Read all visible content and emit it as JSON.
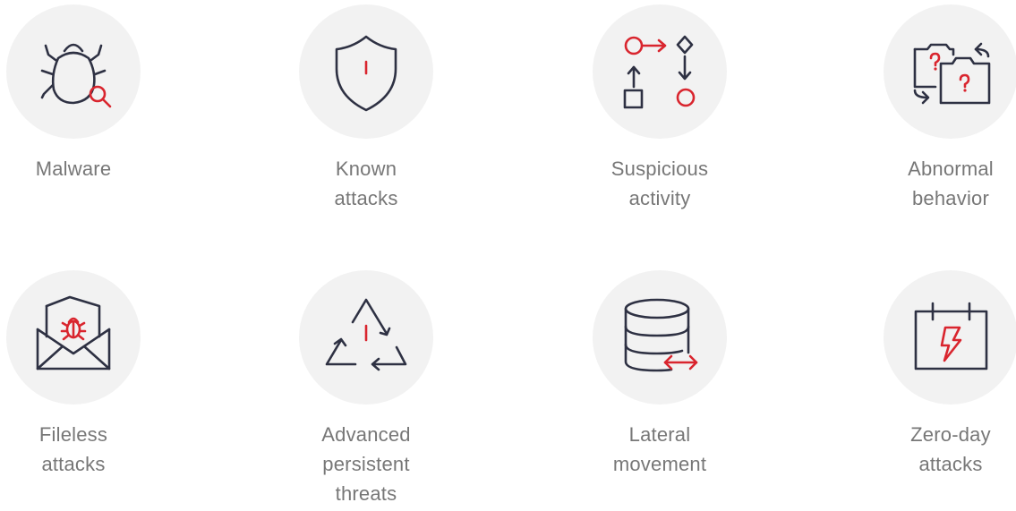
{
  "colors": {
    "icon_dark": "#2e3143",
    "icon_accent": "#d9252e",
    "circle_bg": "#f2f2f2",
    "label_text": "#777777"
  },
  "items": [
    {
      "label": "Malware",
      "icon": "bug-magnifier-icon"
    },
    {
      "label": "Known\nattacks",
      "icon": "shield-alert-icon"
    },
    {
      "label": "Suspicious\nactivity",
      "icon": "flowchart-icon"
    },
    {
      "label": "Abnormal\nbehavior",
      "icon": "swap-folders-icon"
    },
    {
      "label": "Fileless\nattacks",
      "icon": "email-bug-icon"
    },
    {
      "label": "Advanced\npersistent\nthreats",
      "icon": "recycle-alert-icon"
    },
    {
      "label": "Lateral\nmovement",
      "icon": "database-arrows-icon"
    },
    {
      "label": "Zero-day\nattacks",
      "icon": "calendar-lightning-icon"
    }
  ]
}
